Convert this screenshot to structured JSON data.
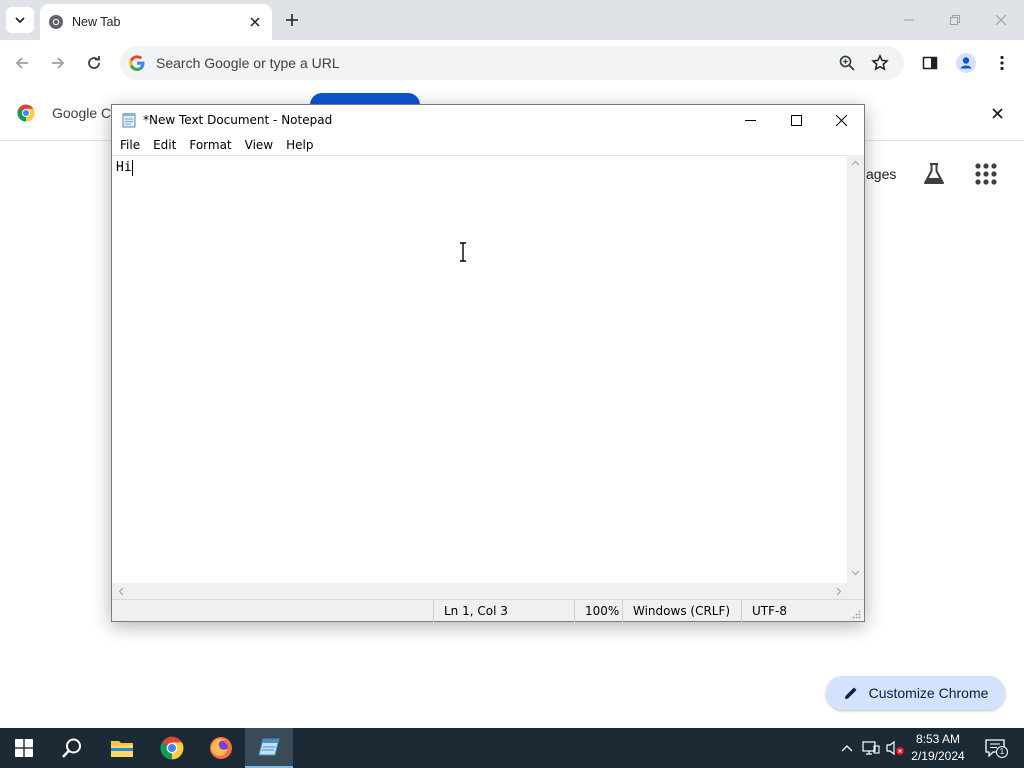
{
  "chrome": {
    "tab_title": "New Tab",
    "omnibox_placeholder": "Search Google or type a URL",
    "bookmark_label": "Google Ch",
    "ntp_images_label": "ages",
    "customize_label": "Customize Chrome"
  },
  "notepad": {
    "title": "*New Text Document - Notepad",
    "menu": [
      "File",
      "Edit",
      "Format",
      "View",
      "Help"
    ],
    "content": "Hi",
    "status": {
      "position": "Ln 1, Col 3",
      "zoom": "100%",
      "line_endings": "Windows (CRLF)",
      "encoding": "UTF-8"
    }
  },
  "taskbar": {
    "time": "8:53 AM",
    "date": "2/19/2024",
    "notification_count": "1"
  },
  "colors": {
    "accent": "#0b57d0",
    "taskbar_bg": "#1c2a36",
    "customize_bg": "#d3e3fd"
  }
}
